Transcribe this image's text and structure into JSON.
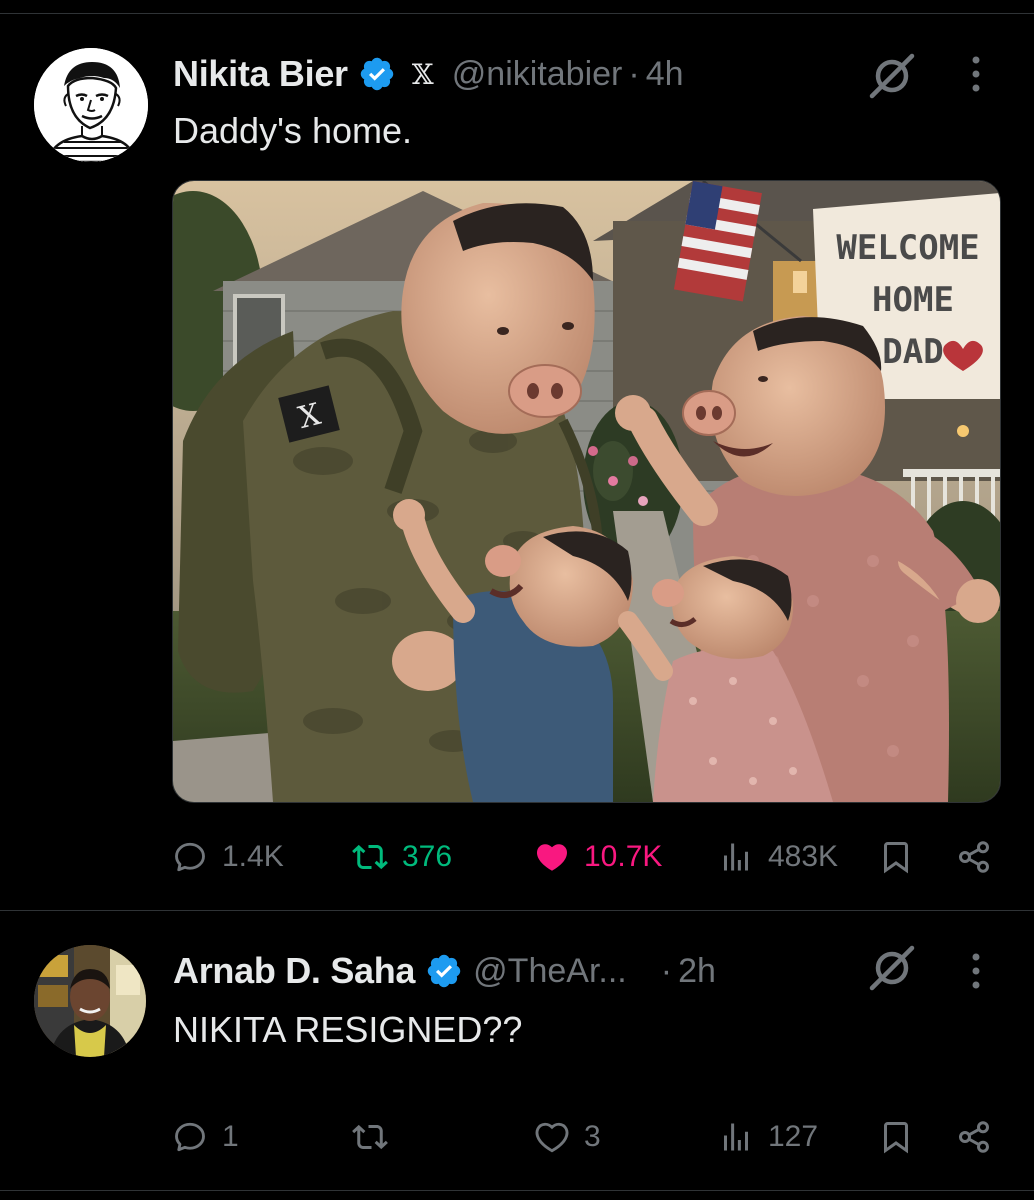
{
  "tweets": [
    {
      "author": {
        "display_name": "Nikita Bier",
        "handle": "@nikitabier",
        "verified": true,
        "affiliation_badge": "𝕏",
        "avatar_icon": "sketch-portrait-avatar"
      },
      "separator": "·",
      "time": "4h",
      "text": "Daddy's home.",
      "media": {
        "type": "image",
        "banner_text": [
          "WELCOME",
          "HOME",
          "DAD"
        ],
        "patch_text": "X"
      },
      "stats": {
        "replies": "1.4K",
        "reposts": "376",
        "likes": "10.7K",
        "views": "483K"
      },
      "reposted_state": "active",
      "liked_state": "active"
    },
    {
      "author": {
        "display_name": "Arnab D. Saha",
        "handle": "@TheAr...",
        "verified": true,
        "avatar_icon": "photo-avatar"
      },
      "separator": "·",
      "time": "2h",
      "text": "NIKITA RESIGNED??",
      "stats": {
        "replies": "1",
        "reposts": "",
        "likes": "3",
        "views": "127"
      }
    }
  ],
  "colors": {
    "background": "#000000",
    "text_primary": "#e7e9ea",
    "text_secondary": "#71767b",
    "verified_blue": "#1d9bf0",
    "repost_green": "#00ba7c",
    "like_pink": "#f91880",
    "divider": "#2f3336"
  }
}
